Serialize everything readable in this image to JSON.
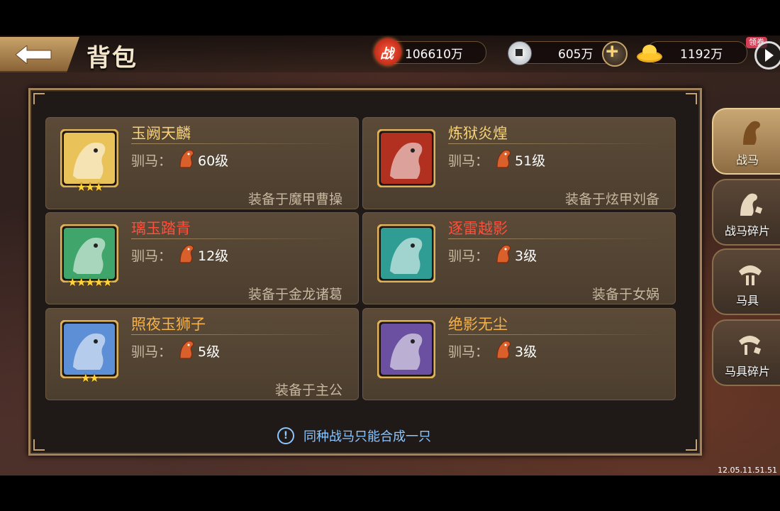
{
  "header": {
    "title": "背包",
    "combat_power": "106610万",
    "combat_power_icon": "combat-power-icon",
    "combat_power_icon_text": "战",
    "silver": "605万",
    "gold": "1192万",
    "badge": "领券"
  },
  "cards": [
    {
      "name": "玉阙天麟",
      "name_color": "#f6d27a",
      "train_label": "驯马：",
      "level": "60级",
      "stars": "★★★",
      "equip": "装备于魔甲曹操",
      "theme": "#e9c25a"
    },
    {
      "name": "炼狱炎煌",
      "name_color": "#f6d27a",
      "train_label": "驯马：",
      "level": "51级",
      "stars": "",
      "equip": "装备于炫甲刘备",
      "theme": "#b23020"
    },
    {
      "name": "璃玉踏青",
      "name_color": "#ff4f3a",
      "train_label": "驯马：",
      "level": "12级",
      "stars": "★★★★★",
      "equip": "装备于金龙诸葛",
      "theme": "#3fa56b"
    },
    {
      "name": "逐雷越影",
      "name_color": "#ff4f3a",
      "train_label": "驯马：",
      "level": "3级",
      "stars": "",
      "equip": "装备于女娲",
      "theme": "#2f9d94"
    },
    {
      "name": "照夜玉狮子",
      "name_color": "#f6b24a",
      "train_label": "驯马：",
      "level": "5级",
      "stars": "★★",
      "equip": "装备于主公",
      "theme": "#5c8fd6"
    },
    {
      "name": "绝影无尘",
      "name_color": "#f6b24a",
      "train_label": "驯马：",
      "level": "3级",
      "stars": "",
      "equip": "",
      "theme": "#6b4fa0"
    }
  ],
  "footer": {
    "message": "同种战马只能合成一只"
  },
  "tabs": [
    {
      "label": "战马",
      "icon": "horse-head-icon",
      "active": true
    },
    {
      "label": "战马碎片",
      "icon": "horse-fragment-icon",
      "active": false
    },
    {
      "label": "马具",
      "icon": "saddle-icon",
      "active": false
    },
    {
      "label": "马具碎片",
      "icon": "saddle-fragment-icon",
      "active": false
    }
  ],
  "clock": "12.05.11.51.51"
}
